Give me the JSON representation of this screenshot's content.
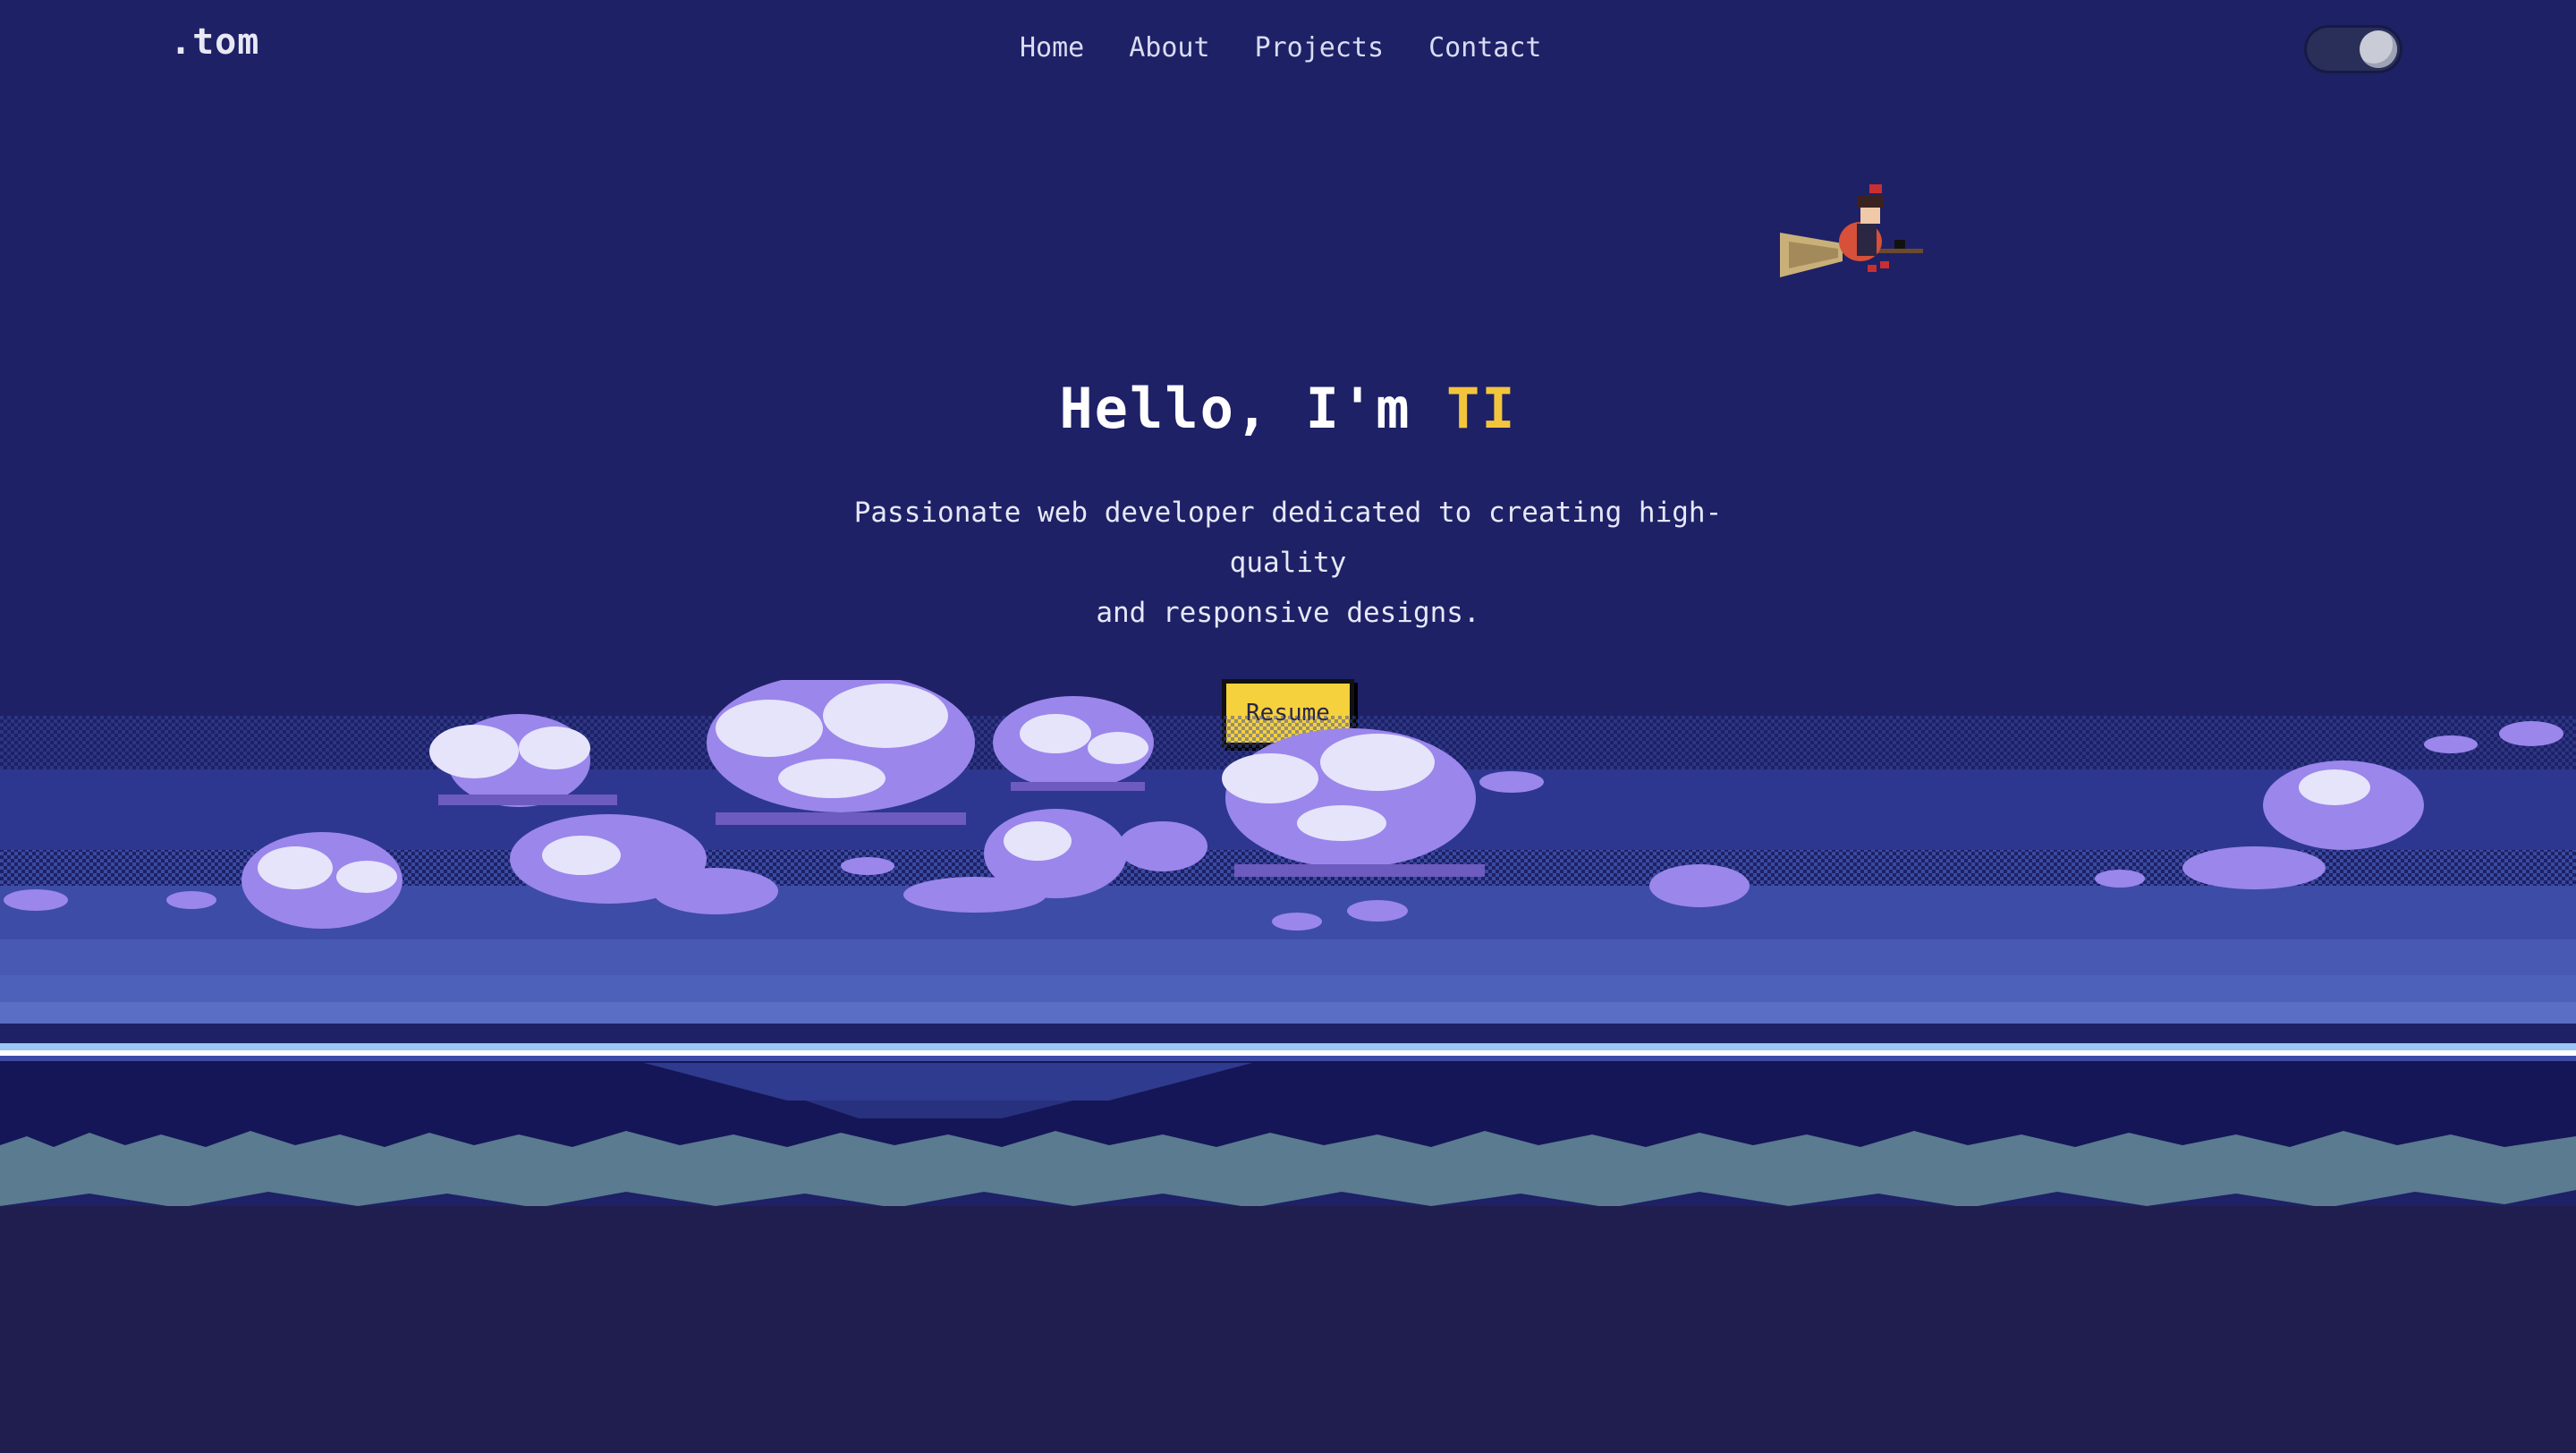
{
  "header": {
    "logo": ".tom",
    "nav": [
      "Home",
      "About",
      "Projects",
      "Contact"
    ]
  },
  "theme_toggle": {
    "state": "on"
  },
  "hero": {
    "greeting": "Hello, I'm",
    "name": "TI",
    "description_line1": "Passionate web developer dedicated to creating high-quality",
    "description_line2": "and responsive designs.",
    "resume_label": "Resume"
  },
  "colors": {
    "background": "#1e2166",
    "accent_yellow": "#f3c53c",
    "button_yellow": "#f5d13d",
    "cloud_purple": "#9b86ec",
    "water": "#151657",
    "grass": "#5a7b90",
    "ground": "#201e4e"
  },
  "icons": {
    "toggle": "toggle-switch-icon",
    "character": "witch-on-broom-icon"
  }
}
